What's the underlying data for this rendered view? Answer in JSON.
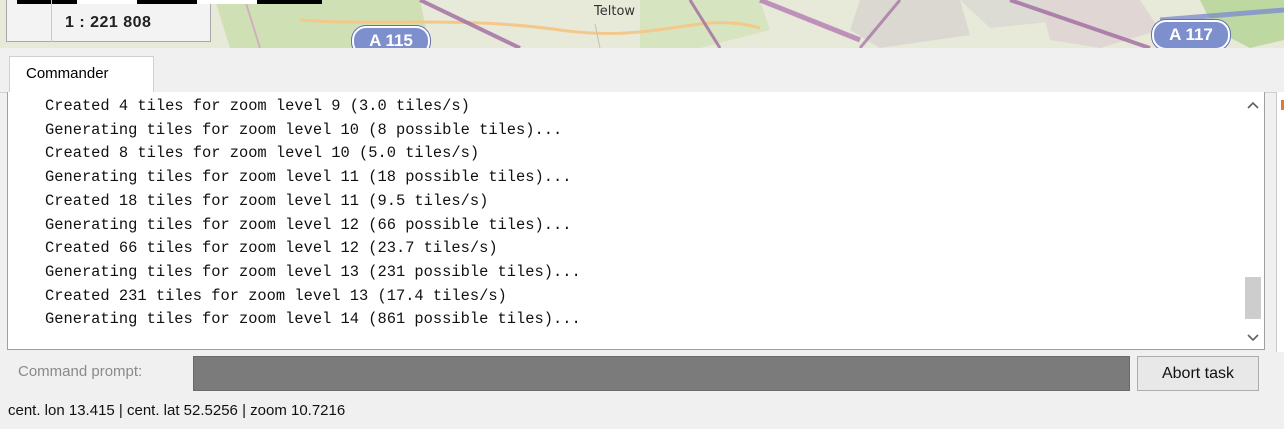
{
  "map": {
    "scale": "1 : 221 808",
    "place_label": "Teltow",
    "shields": [
      "A 115",
      "A 117"
    ]
  },
  "tabs": [
    {
      "label": "Commander"
    }
  ],
  "console": {
    "lines": [
      "Created 4 tiles for zoom level 9 (3.0 tiles/s)",
      "Generating tiles for zoom level 10 (8 possible tiles)...",
      "Created 8 tiles for zoom level 10 (5.0 tiles/s)",
      "Generating tiles for zoom level 11 (18 possible tiles)...",
      "Created 18 tiles for zoom level 11 (9.5 tiles/s)",
      "Generating tiles for zoom level 12 (66 possible tiles)...",
      "Created 66 tiles for zoom level 12 (23.7 tiles/s)",
      "Generating tiles for zoom level 13 (231 possible tiles)...",
      "Created 231 tiles for zoom level 13 (17.4 tiles/s)",
      "Generating tiles for zoom level 14 (861 possible tiles)..."
    ],
    "scroll_up_icon": "chevron-up",
    "scroll_down_icon": "chevron-down"
  },
  "command": {
    "label": "Command prompt:",
    "value": "",
    "abort_label": "Abort task"
  },
  "status": {
    "text": "cent. lon 13.415 | cent. lat 52.5256 | zoom 10.7216"
  },
  "colors": {
    "motorway": "#7e8fcd",
    "road_purple": "#a06aa0",
    "input_disabled": "#7b7b7b"
  }
}
